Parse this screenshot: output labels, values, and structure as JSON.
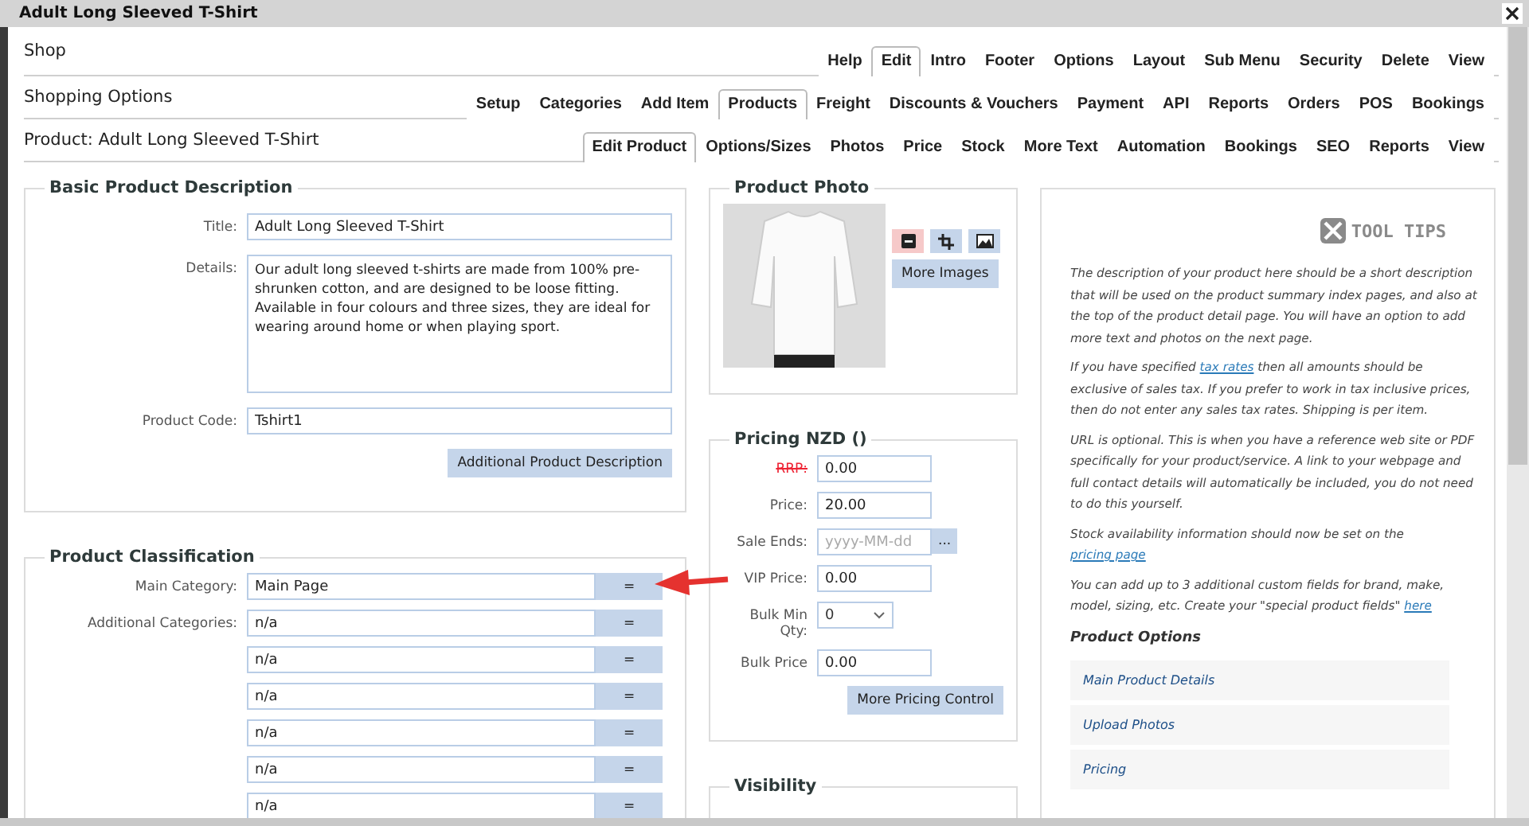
{
  "window": {
    "title": "Adult Long Sleeved T-Shirt"
  },
  "nav_rows": [
    {
      "heading": "Shop",
      "tabs": [
        {
          "label": "Help",
          "selected": false
        },
        {
          "label": "Edit",
          "selected": true
        },
        {
          "label": "Intro",
          "selected": false
        },
        {
          "label": "Footer",
          "selected": false
        },
        {
          "label": "Options",
          "selected": false
        },
        {
          "label": "Layout",
          "selected": false
        },
        {
          "label": "Sub Menu",
          "selected": false
        },
        {
          "label": "Security",
          "selected": false
        },
        {
          "label": "Delete",
          "selected": false
        },
        {
          "label": "View",
          "selected": false
        }
      ]
    },
    {
      "heading": "Shopping Options",
      "tabs": [
        {
          "label": "Setup",
          "selected": false
        },
        {
          "label": "Categories",
          "selected": false
        },
        {
          "label": "Add Item",
          "selected": false
        },
        {
          "label": "Products",
          "selected": true
        },
        {
          "label": "Freight",
          "selected": false
        },
        {
          "label": "Discounts & Vouchers",
          "selected": false
        },
        {
          "label": "Payment",
          "selected": false
        },
        {
          "label": "API",
          "selected": false
        },
        {
          "label": "Reports",
          "selected": false
        },
        {
          "label": "Orders",
          "selected": false
        },
        {
          "label": "POS",
          "selected": false
        },
        {
          "label": "Bookings",
          "selected": false
        }
      ]
    },
    {
      "heading": "Product: Adult Long Sleeved T-Shirt",
      "tabs": [
        {
          "label": "Edit Product",
          "selected": true
        },
        {
          "label": "Options/Sizes",
          "selected": false
        },
        {
          "label": "Photos",
          "selected": false
        },
        {
          "label": "Price",
          "selected": false
        },
        {
          "label": "Stock",
          "selected": false
        },
        {
          "label": "More Text",
          "selected": false
        },
        {
          "label": "Automation",
          "selected": false
        },
        {
          "label": "Bookings",
          "selected": false
        },
        {
          "label": "SEO",
          "selected": false
        },
        {
          "label": "Reports",
          "selected": false
        },
        {
          "label": "View",
          "selected": false
        }
      ]
    }
  ],
  "basic": {
    "legend": "Basic Product Description",
    "title_label": "Title:",
    "title_value": "Adult Long Sleeved T-Shirt",
    "details_label": "Details:",
    "details_value": "Our adult long sleeved t-shirts are made from 100% pre-shrunken cotton, and are designed to be loose fitting. Available in four colours and three sizes, they are ideal for wearing around home or when playing sport.",
    "code_label": "Product Code:",
    "code_value": "Tshirt1",
    "button": "Additional Product Description"
  },
  "classification": {
    "legend": "Product Classification",
    "main_label": "Main Category:",
    "additional_label": "Additional Categories:",
    "button": "=",
    "categories": [
      "Main Page",
      "n/a",
      "n/a",
      "n/a",
      "n/a",
      "n/a",
      "n/a"
    ]
  },
  "photo": {
    "legend": "Product Photo",
    "button": "More Images"
  },
  "pricing": {
    "legend": "Pricing NZD ()",
    "rows": [
      {
        "kind": "text",
        "label": "RRP:",
        "struck": true,
        "value": "0.00"
      },
      {
        "kind": "text",
        "label": "Price:",
        "struck": false,
        "value": "20.00"
      },
      {
        "kind": "date",
        "label": "Sale Ends:",
        "struck": false,
        "placeholder": "yyyy-MM-dd",
        "button": "..."
      },
      {
        "kind": "text",
        "label": "VIP Price:",
        "struck": false,
        "value": "0.00"
      },
      {
        "kind": "select",
        "label": "Bulk Min Qty:",
        "struck": false,
        "value": "0"
      },
      {
        "kind": "text",
        "label": "Bulk Price",
        "struck": false,
        "value": "0.00"
      }
    ],
    "button": "More Pricing Control"
  },
  "visibility": {
    "legend": "Visibility"
  },
  "tool_tips": {
    "heading": "TOOL TIPS",
    "paragraphs": [
      {
        "text": "The description of your product here should be a short description that will be used on the product summary index pages, and also at the top of the product detail page. You will have an option to add more text and photos on the next page."
      },
      {
        "text": "If you have specified ",
        "link": "tax rates",
        "after": " then all amounts should be exclusive of sales tax. If you prefer to work in tax inclusive prices, then do not enter any sales tax rates. Shipping is per item."
      },
      {
        "text": "URL is optional. This is when you have a reference web site or PDF specifically for your product/service. A link to your webpage and full contact details will automatically be included, you do not need to do this yourself."
      },
      {
        "text": "Stock availability information should now be set on the ",
        "link": "pricing page"
      },
      {
        "text": "You can add up to 3 additional custom fields for brand, make, model, sizing, etc. Create your \"special product fields\" ",
        "link": "here"
      }
    ],
    "options_heading": "Product Options",
    "options": [
      "Main Product Details",
      "Upload Photos",
      "Pricing"
    ]
  }
}
